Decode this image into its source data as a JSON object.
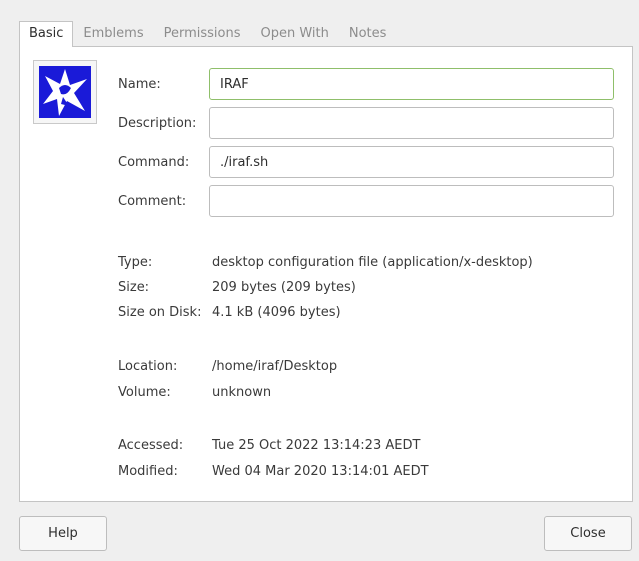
{
  "tabs": [
    {
      "label": "Basic",
      "active": true
    },
    {
      "label": "Emblems",
      "active": false
    },
    {
      "label": "Permissions",
      "active": false
    },
    {
      "label": "Open With",
      "active": false
    },
    {
      "label": "Notes",
      "active": false
    }
  ],
  "icon": {
    "name": "iraf-app-icon",
    "background": "#1a1ad8"
  },
  "fields": {
    "name": {
      "label": "Name:",
      "value": "IRAF"
    },
    "description": {
      "label": "Description:",
      "value": ""
    },
    "command": {
      "label": "Command:",
      "value": "./iraf.sh"
    },
    "comment": {
      "label": "Comment:",
      "value": ""
    }
  },
  "info": {
    "type": {
      "label": "Type:",
      "value": "desktop configuration file (application/x-desktop)"
    },
    "size": {
      "label": "Size:",
      "value": "209 bytes (209 bytes)"
    },
    "size_on_disk": {
      "label": "Size on Disk:",
      "value": "4.1 kB (4096 bytes)"
    },
    "location": {
      "label": "Location:",
      "value": "/home/iraf/Desktop"
    },
    "volume": {
      "label": "Volume:",
      "value": "unknown"
    },
    "accessed": {
      "label": "Accessed:",
      "value": "Tue 25 Oct 2022 13:14:23 AEDT"
    },
    "modified": {
      "label": "Modified:",
      "value": "Wed 04 Mar 2020 13:14:01 AEDT"
    }
  },
  "buttons": {
    "help": "Help",
    "close": "Close"
  },
  "colors": {
    "focus_border": "#8fbf6a",
    "panel_bg": "#ffffff",
    "window_bg": "#efefef"
  }
}
